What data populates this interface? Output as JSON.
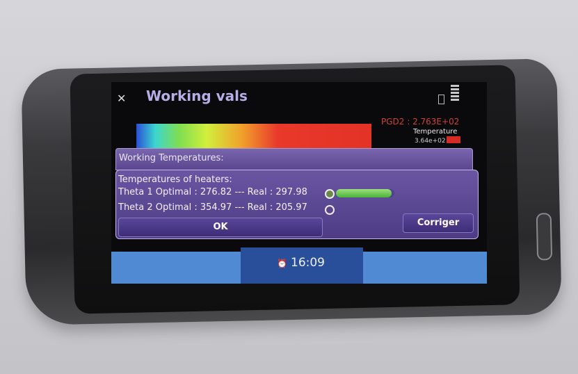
{
  "app": {
    "title": "Working vals",
    "close_icon": "close-icon"
  },
  "status_icons": [
    "battery-icon",
    "signal-icon"
  ],
  "plot": {
    "pgd_label": "PGD2 : 2.763E+02",
    "legend_title": "Temperature",
    "legend_value": "3.64e+02",
    "colors": {
      "low": "#2b4fd6",
      "mid": "#7ede52",
      "high": "#e33226"
    }
  },
  "dialog": {
    "header": "Working Temperatures:",
    "section_title": "Temperatures of heaters:",
    "rows": [
      {
        "text": "Theta 1 Optimal : 276.82 --- Real : 297.98",
        "selected": true
      },
      {
        "text": "Theta 2 Optimal : 354.97 --- Real : 205.97",
        "selected": false
      }
    ],
    "progress_fraction": 0.95,
    "ok_label": "OK",
    "corriger_label": "Corriger"
  },
  "bottom_bar": {
    "time": "16:09",
    "clock_icon": "alarm-clock-icon"
  }
}
